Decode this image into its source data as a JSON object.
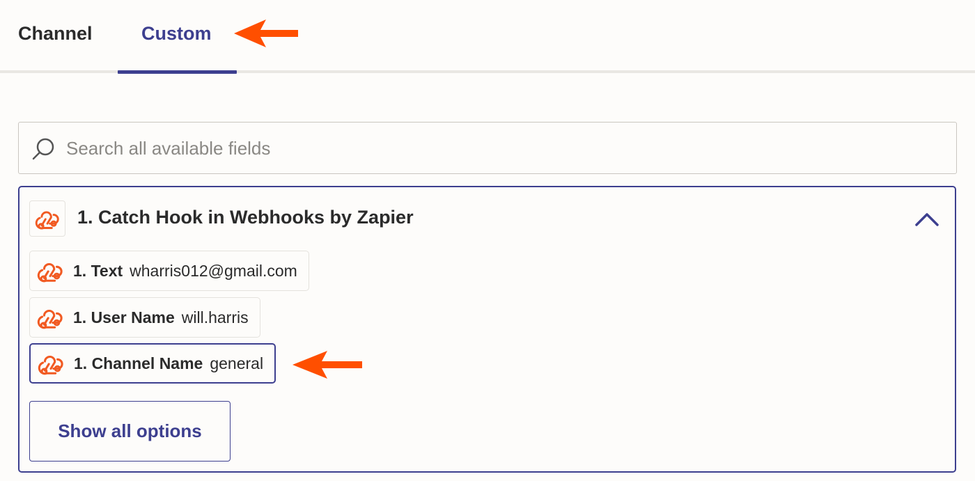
{
  "tabs": [
    {
      "label": "Channel",
      "active": false
    },
    {
      "label": "Custom",
      "active": true
    }
  ],
  "search": {
    "placeholder": "Search all available fields",
    "value": ""
  },
  "panel": {
    "title": "1. Catch Hook in Webhooks by Zapier",
    "icon": "webhook-icon",
    "expanded": true,
    "fields": [
      {
        "key": "1. Text",
        "value": "wharris012@gmail.com",
        "selected": false
      },
      {
        "key": "1. User Name",
        "value": "will.harris",
        "selected": false
      },
      {
        "key": "1. Channel Name",
        "value": "general",
        "selected": true
      }
    ],
    "show_all_label": "Show all options"
  },
  "colors": {
    "accent": "#3d3f8f",
    "webhook_icon": "#f15a22",
    "annotation_arrow": "#ff4f00",
    "background": "#fdfcfa"
  }
}
